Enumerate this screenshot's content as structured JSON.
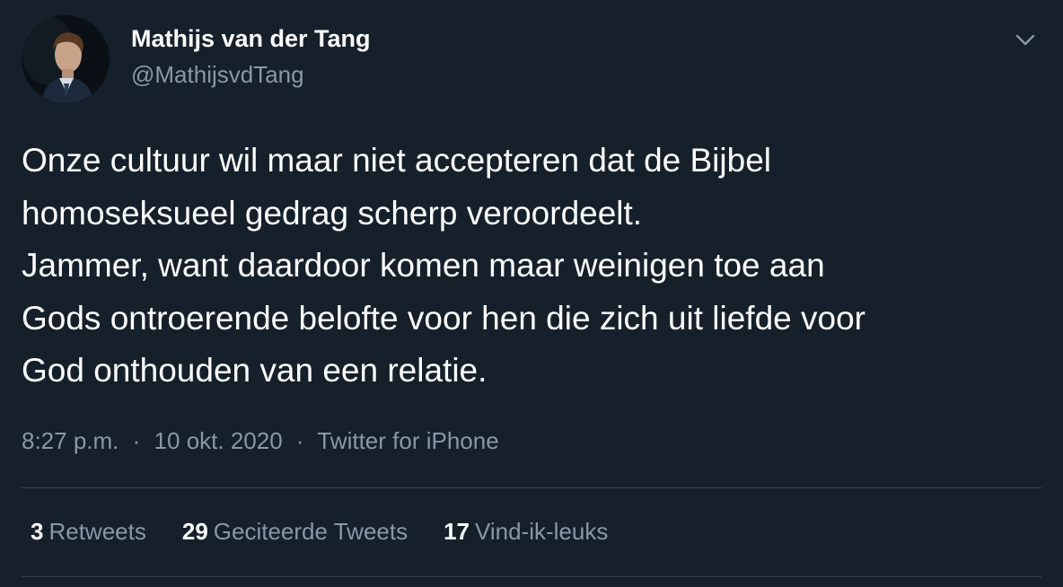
{
  "user": {
    "display_name": "Mathijs van der Tang",
    "handle": "@MathijsvdTang"
  },
  "tweet": {
    "lines": [
      "Onze cultuur wil maar niet accepteren dat de Bijbel",
      "homoseksueel gedrag scherp veroordeelt.",
      "Jammer, want daardoor komen maar weinigen toe aan",
      "Gods ontroerende belofte voor hen die zich uit liefde voor",
      "God onthouden van een relatie."
    ],
    "time": "8:27 p.m.",
    "date": "10 okt. 2020",
    "source": "Twitter for iPhone",
    "separator": "·"
  },
  "stats": {
    "retweets": {
      "count": "3",
      "label": "Retweets"
    },
    "quotes": {
      "count": "29",
      "label": "Geciteerde Tweets"
    },
    "likes": {
      "count": "17",
      "label": "Vind-ik-leuks"
    }
  },
  "icons": {
    "menu": "chevron-down-icon"
  },
  "colors": {
    "background": "#15202b",
    "text": "#ffffff",
    "secondary_text": "#8899a6",
    "divider": "#38444d"
  }
}
